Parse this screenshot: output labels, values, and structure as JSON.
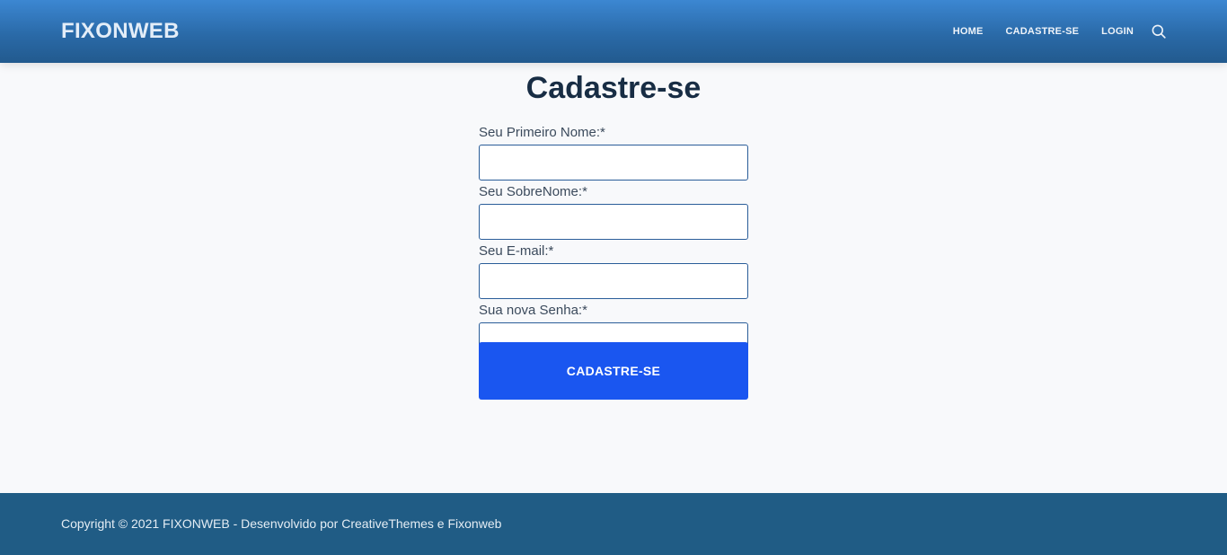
{
  "header": {
    "logo": "FIXONWEB",
    "nav": [
      {
        "label": "HOME"
      },
      {
        "label": "CADASTRE-SE"
      },
      {
        "label": "LOGIN"
      }
    ],
    "search_icon": "search-icon"
  },
  "main": {
    "title": "Cadastre-se",
    "form": {
      "first_name_label": "Seu Primeiro Nome:*",
      "first_name_value": "",
      "last_name_label": "Seu SobreNome:*",
      "last_name_value": "",
      "email_label": "Seu E-mail:*",
      "email_value": "",
      "password_label": "Sua nova Senha:*",
      "password_value": "",
      "submit_label": "CADASTRE-SE"
    }
  },
  "footer": {
    "copyright": "Copyright © 2021 FIXONWEB - Desenvolvido por CreativeThemes e Fixonweb"
  },
  "colors": {
    "header_gradient_top": "#3c87d2",
    "header_gradient_bottom": "#225a8e",
    "button": "#1a56f0",
    "footer": "#205c85",
    "title": "#182d44"
  }
}
